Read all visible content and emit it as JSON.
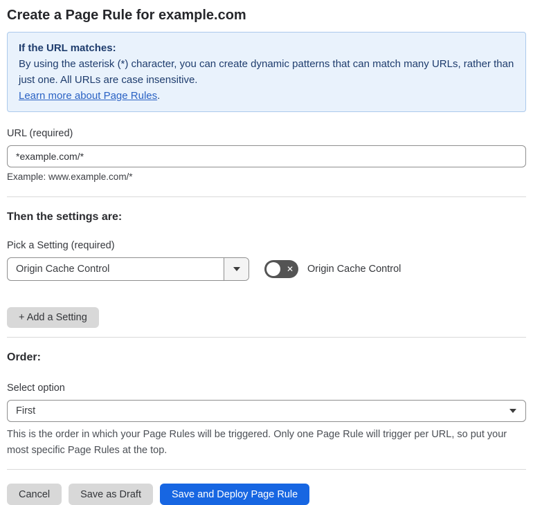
{
  "page": {
    "title": "Create a Page Rule for example.com"
  },
  "info_box": {
    "heading": "If the URL matches:",
    "body": "By using the asterisk (*) character, you can create dynamic patterns that can match many URLs, rather than just one. All URLs are case insensitive.",
    "link": "Learn more about Page Rules",
    "link_suffix": "."
  },
  "url_section": {
    "label": "URL (required)",
    "value": "*example.com/*",
    "example": "Example: www.example.com/*"
  },
  "settings_section": {
    "heading": "Then the settings are:",
    "pick_label": "Pick a Setting (required)",
    "selected_setting": "Origin Cache Control",
    "toggle_label": "Origin Cache Control",
    "toggle_state": "off",
    "toggle_icon": "✕",
    "add_button": "+ Add a Setting"
  },
  "order_section": {
    "heading": "Order:",
    "label": "Select option",
    "selected": "First",
    "help": "This is the order in which your Page Rules will be triggered. Only one Page Rule will trigger per URL, so put your most specific Page Rules at the top."
  },
  "footer": {
    "cancel": "Cancel",
    "save_draft": "Save as Draft",
    "save_deploy": "Save and Deploy Page Rule"
  },
  "colors": {
    "accent_blue": "#1766e2",
    "info_bg": "#e9f2fc",
    "info_border": "#abc9ec",
    "info_text": "#1e3c6d",
    "link_blue": "#2a62c4",
    "toggle_bg": "#545454",
    "button_gray": "#d8d8d8"
  }
}
